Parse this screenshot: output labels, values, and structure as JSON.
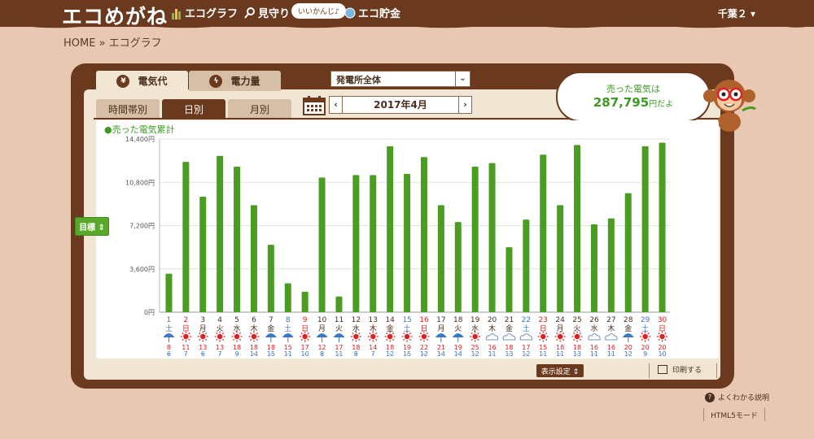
{
  "header": {
    "logo": "エコめがね",
    "nav": [
      {
        "label": "エコグラフ",
        "icon": "bar-chart-icon"
      },
      {
        "label": "見守り",
        "icon": "magnifier-icon"
      },
      {
        "label": "エコ貯金",
        "icon": "coin-icon"
      }
    ],
    "pill": "いいかんじ♪",
    "user": "千葉２ ▾"
  },
  "breadcrumb": "HOME » エコグラフ",
  "tabs": {
    "sold": "電気代",
    "amount": "電力量",
    "sold_icon": "yen-icon",
    "amount_icon": "bolt-icon"
  },
  "select": {
    "value": "発電所全体"
  },
  "subtabs": [
    "時間帯別",
    "日別",
    "月別"
  ],
  "date": {
    "label": "2017年4月",
    "prev": "‹",
    "next": "›"
  },
  "bubble": {
    "line1": "売った電気は",
    "amount": "287,795",
    "suffix": "円だよ"
  },
  "legend": "●売った電気累計",
  "goal_button": "目標 ⇕",
  "bottom": {
    "display": "表示設定 ⇕",
    "print": "印刷する",
    "help": "よくわかる説明",
    "html5": "HTML5モード"
  },
  "colors": {
    "bar": "#4a9c22",
    "header": "#6b3a1e",
    "sun": "#e02020",
    "umbrella": "#3a7ac0",
    "cloud": "#7a9ac0"
  },
  "chart_data": {
    "type": "bar",
    "title": "売った電気累計",
    "ylim": [
      0,
      14400
    ],
    "yticks": [
      "0円",
      "3,600円",
      "7,200円",
      "10,800円",
      "14,400円"
    ],
    "days": [
      {
        "d": "1",
        "w": "土",
        "weather": "umbrella",
        "hi": "8",
        "lo": "6",
        "v": 3200
      },
      {
        "d": "2",
        "w": "日",
        "weather": "sun",
        "hi": "11",
        "lo": "7",
        "v": 12500
      },
      {
        "d": "3",
        "w": "月",
        "weather": "sun",
        "hi": "13",
        "lo": "6",
        "v": 9600
      },
      {
        "d": "4",
        "w": "火",
        "weather": "sun",
        "hi": "13",
        "lo": "7",
        "v": 13000
      },
      {
        "d": "5",
        "w": "水",
        "weather": "sun",
        "hi": "18",
        "lo": "9",
        "v": 12100
      },
      {
        "d": "6",
        "w": "木",
        "weather": "sun",
        "hi": "18",
        "lo": "14",
        "v": 8900
      },
      {
        "d": "7",
        "w": "金",
        "weather": "umbrella",
        "hi": "18",
        "lo": "15",
        "v": 5600
      },
      {
        "d": "8",
        "w": "土",
        "weather": "umbrella",
        "hi": "15",
        "lo": "11",
        "v": 2400
      },
      {
        "d": "9",
        "w": "日",
        "weather": "sun",
        "hi": "17",
        "lo": "10",
        "v": 1700
      },
      {
        "d": "10",
        "w": "月",
        "weather": "umbrella",
        "hi": "12",
        "lo": "8",
        "v": 11200
      },
      {
        "d": "11",
        "w": "火",
        "weather": "umbrella",
        "hi": "17",
        "lo": "11",
        "v": 1300
      },
      {
        "d": "12",
        "w": "水",
        "weather": "sun",
        "hi": "18",
        "lo": "8",
        "v": 11400
      },
      {
        "d": "13",
        "w": "木",
        "weather": "sun",
        "hi": "14",
        "lo": "7",
        "v": 11400
      },
      {
        "d": "14",
        "w": "金",
        "weather": "sun",
        "hi": "18",
        "lo": "12",
        "v": 13800
      },
      {
        "d": "15",
        "w": "土",
        "weather": "sun",
        "hi": "19",
        "lo": "15",
        "v": 11500
      },
      {
        "d": "16",
        "w": "日",
        "weather": "sun",
        "hi": "22",
        "lo": "12",
        "v": 12900
      },
      {
        "d": "17",
        "w": "月",
        "weather": "umbrella",
        "hi": "21",
        "lo": "14",
        "v": 8900
      },
      {
        "d": "18",
        "w": "火",
        "weather": "umbrella",
        "hi": "19",
        "lo": "14",
        "v": 7500
      },
      {
        "d": "19",
        "w": "水",
        "weather": "sun",
        "hi": "25",
        "lo": "12",
        "v": 12100
      },
      {
        "d": "20",
        "w": "木",
        "weather": "cloud",
        "hi": "16",
        "lo": "11",
        "v": 12400
      },
      {
        "d": "21",
        "w": "金",
        "weather": "cloud",
        "hi": "18",
        "lo": "13",
        "v": 5400
      },
      {
        "d": "22",
        "w": "土",
        "weather": "cloud",
        "hi": "17",
        "lo": "12",
        "v": 7700
      },
      {
        "d": "23",
        "w": "日",
        "weather": "sun",
        "hi": "15",
        "lo": "11",
        "v": 13100
      },
      {
        "d": "24",
        "w": "月",
        "weather": "sun",
        "hi": "18",
        "lo": "11",
        "v": 8900
      },
      {
        "d": "25",
        "w": "火",
        "weather": "sun",
        "hi": "18",
        "lo": "13",
        "v": 13900
      },
      {
        "d": "26",
        "w": "水",
        "weather": "cloud",
        "hi": "16",
        "lo": "11",
        "v": 7300
      },
      {
        "d": "27",
        "w": "木",
        "weather": "cloud",
        "hi": "16",
        "lo": "11",
        "v": 7800
      },
      {
        "d": "28",
        "w": "金",
        "weather": "umbrella",
        "hi": "20",
        "lo": "12",
        "v": 9900
      },
      {
        "d": "29",
        "w": "土",
        "weather": "sun",
        "hi": "20",
        "lo": "9",
        "v": 13800
      },
      {
        "d": "30",
        "w": "日",
        "weather": "sun",
        "hi": "20",
        "lo": "10",
        "v": 14100
      }
    ]
  }
}
